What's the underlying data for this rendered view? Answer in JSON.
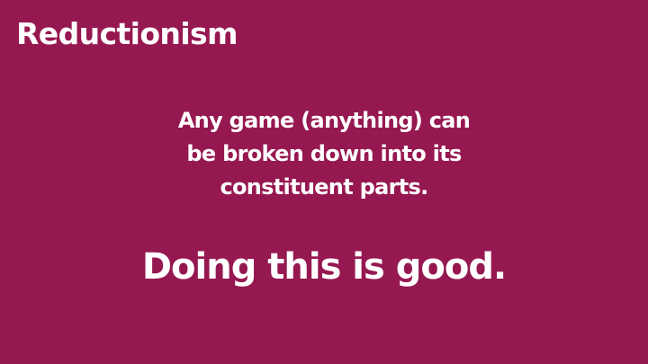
{
  "slide": {
    "title": "Reductionism",
    "body_lines": [
      "Any game (anything) can",
      "be broken down into its",
      "constituent parts."
    ],
    "emphasis": "Doing this is good.",
    "background_color": "#961851",
    "text_color": "#ffffff"
  }
}
